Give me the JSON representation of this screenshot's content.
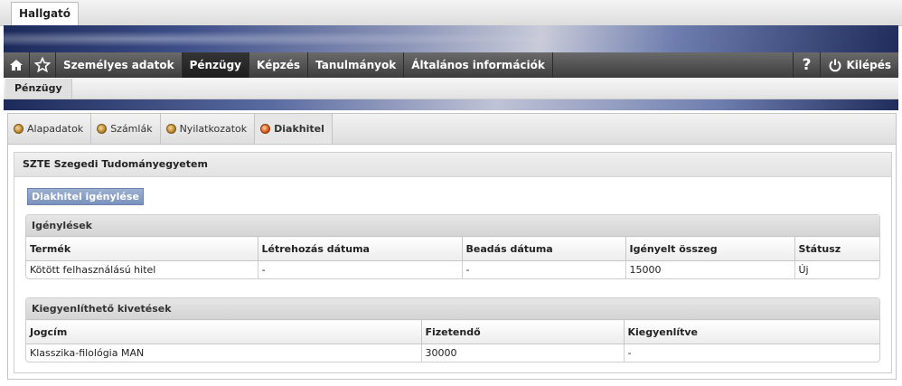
{
  "role_tab": "Hallgató",
  "nav": {
    "items": [
      "Személyes adatok",
      "Pénzügy",
      "Képzés",
      "Tanulmányok",
      "Általános információk"
    ],
    "active_index": 1,
    "help_label": "?",
    "logout_label": "Kilépés"
  },
  "subnav": {
    "label": "Pénzügy"
  },
  "tabs": [
    {
      "label": "Alapadatok"
    },
    {
      "label": "Számlák"
    },
    {
      "label": "Nyilatkozatok"
    },
    {
      "label": "Diakhitel"
    }
  ],
  "panel_title": "SZTE Szegedi Tudományegyetem",
  "request_button": "Diakhitel igénylése",
  "requests": {
    "title": "Igénylések",
    "columns": [
      "Termék",
      "Létrehozás dátuma",
      "Beadás dátuma",
      "Igényelt összeg",
      "Státusz"
    ],
    "rows": [
      [
        "Kötött felhasználású hitel",
        "-",
        "-",
        "15000",
        "Új"
      ]
    ]
  },
  "payables": {
    "title": "Kiegyenlíthető kivetések",
    "columns": [
      "Jogcím",
      "Fizetendő",
      "Kiegyenlítve"
    ],
    "rows": [
      [
        "Klasszika-filológia MAN",
        "30000",
        "-"
      ]
    ]
  }
}
